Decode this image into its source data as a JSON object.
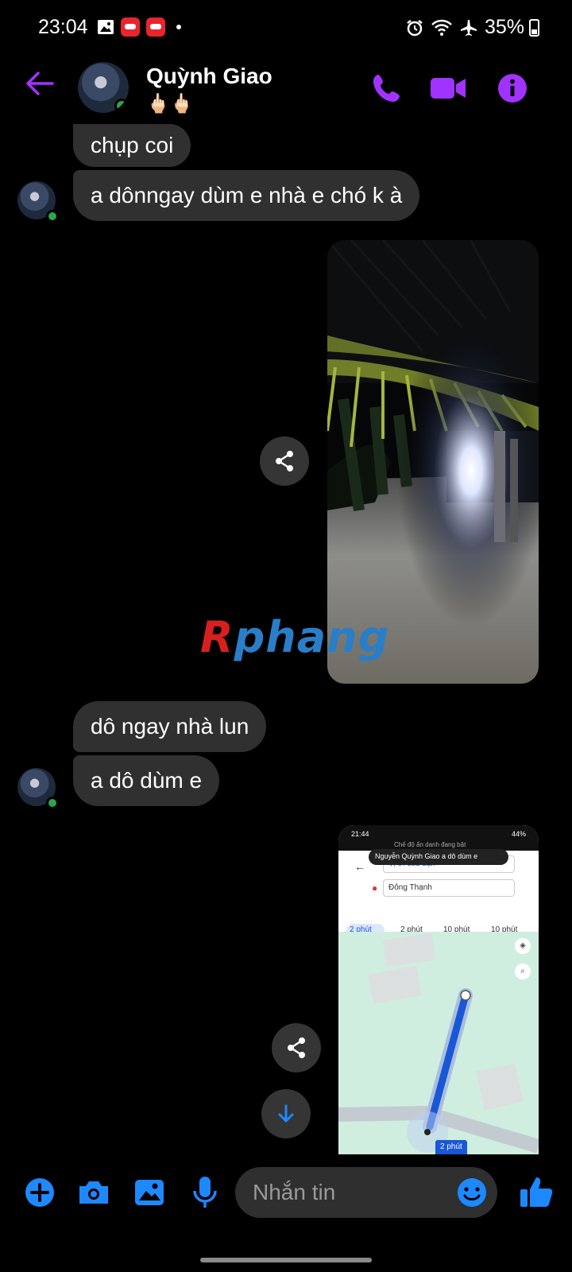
{
  "status_bar": {
    "time": "23:04",
    "battery": "35%",
    "battery_level": 0.35,
    "icons_left": [
      "gallery-icon",
      "app-notification-icon",
      "app-notification-icon",
      "more-dot-icon"
    ],
    "icons_right": [
      "alarm-icon",
      "wifi-icon",
      "airplane-icon"
    ]
  },
  "header": {
    "name": "Quỳnh Giao",
    "subtitle": "🖕🏻🖕🏻",
    "online": true,
    "accent": "#a033ff",
    "actions": [
      "call-icon",
      "video-call-icon",
      "info-icon"
    ]
  },
  "messages": [
    {
      "from": "them",
      "type": "text",
      "text": "chụp coi"
    },
    {
      "from": "them",
      "type": "text",
      "text": "a dônngay dùm e nhà e chó k à"
    },
    {
      "from": "me",
      "type": "image",
      "desc_icon": "photo"
    },
    {
      "from": "them",
      "type": "text",
      "text": "dô ngay nhà lun"
    },
    {
      "from": "them",
      "type": "text",
      "text": "a dô dùm e"
    },
    {
      "from": "me",
      "type": "image",
      "desc_icon": "map-screenshot"
    }
  ],
  "map_screenshot": {
    "time": "21:44",
    "battery": "44%",
    "banner": "Chế độ ẩn danh đang bật",
    "notification": "Nguyễn Quỳnh Giao  a dô dùm e",
    "from_field": "Vị trí của bạn",
    "to_field": "Đông Thạnh",
    "modes": [
      {
        "icon": "car",
        "label": "2 phút"
      },
      {
        "icon": "motorbike",
        "label": "2 phút"
      },
      {
        "icon": "transit",
        "label": "10 phút"
      },
      {
        "icon": "walk",
        "label": "10 phút"
      }
    ],
    "route_chip": "2 phút"
  },
  "watermark": {
    "first": "R",
    "rest": "phang"
  },
  "composer": {
    "placeholder": "Nhắn tin",
    "accent": "#1e88ff"
  }
}
